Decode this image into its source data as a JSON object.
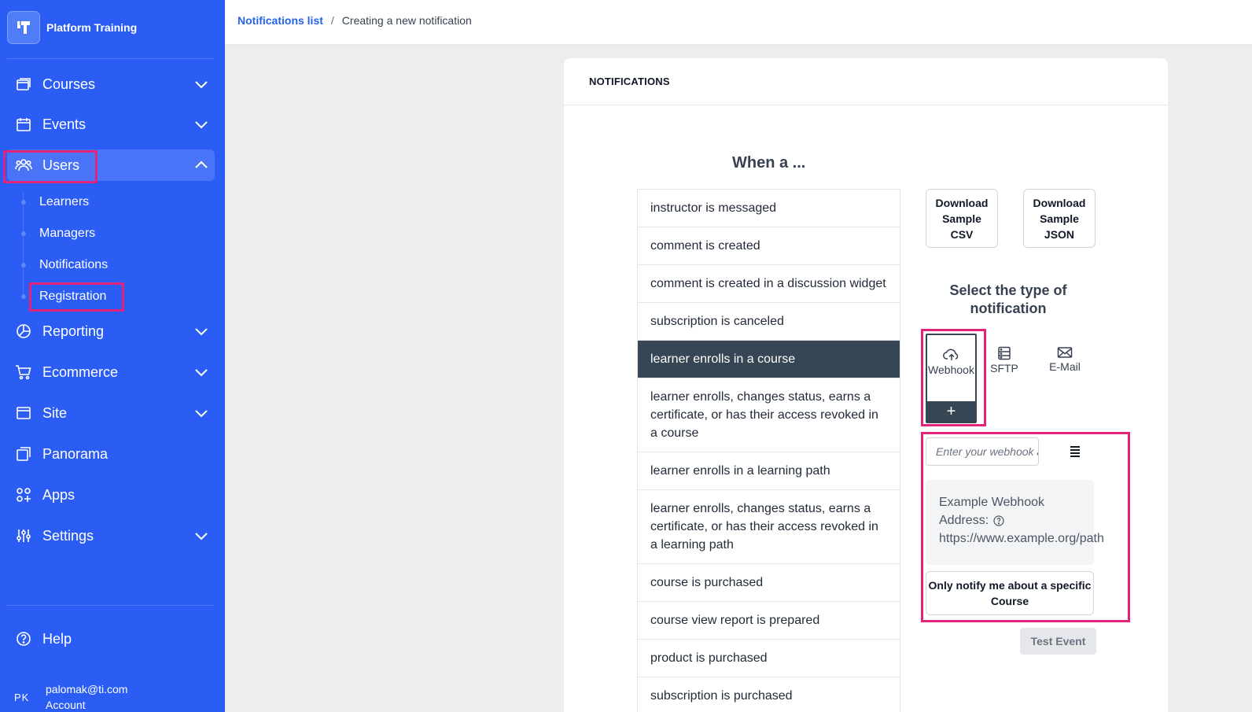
{
  "brand": {
    "name": "Platform Training",
    "logo_text": "T"
  },
  "sidebar": {
    "items": [
      {
        "label": "Courses",
        "icon": "courses-icon"
      },
      {
        "label": "Events",
        "icon": "calendar-icon"
      },
      {
        "label": "Users",
        "icon": "users-icon",
        "expanded": true
      },
      {
        "label": "Reporting",
        "icon": "pie-chart-icon"
      },
      {
        "label": "Ecommerce",
        "icon": "cart-icon"
      },
      {
        "label": "Site",
        "icon": "browser-icon"
      },
      {
        "label": "Panorama",
        "icon": "panorama-icon"
      },
      {
        "label": "Apps",
        "icon": "apps-icon"
      },
      {
        "label": "Settings",
        "icon": "sliders-icon"
      }
    ],
    "users_sub": [
      "Learners",
      "Managers",
      "Notifications",
      "Registration"
    ],
    "help": "Help",
    "account": {
      "initials": "PK",
      "email": "palomak@ti.com",
      "label": "Account"
    }
  },
  "breadcrumb": {
    "link": "Notifications list",
    "separator": "/",
    "current": "Creating a new notification"
  },
  "card": {
    "header": "NOTIFICATIONS",
    "when_title": "When a ...",
    "events": [
      "instructor is messaged",
      "comment is created",
      "comment is created in a discussion widget",
      "subscription is canceled",
      "learner enrolls in a course",
      "learner enrolls, changes status, earns a certificate, or has their access revoked in a course",
      "learner enrolls in a learning path",
      "learner enrolls, changes status, earns a certificate, or has their access revoked in a learning path",
      "course is purchased",
      "course view report is prepared",
      "product is purchased",
      "subscription is purchased"
    ],
    "selected_event": "learner enrolls in a course",
    "download_csv": [
      "Download",
      "Sample",
      "CSV"
    ],
    "download_json": [
      "Download",
      "Sample",
      "JSON"
    ],
    "select_type_title": "Select the type of notification",
    "types": {
      "webhook": "Webhook",
      "sftp": "SFTP",
      "email": "E-Mail",
      "add": "+"
    },
    "webhook_placeholder": "Enter your webhook address",
    "example": {
      "label": "Example Webhook",
      "address_label": "Address:",
      "url": "https://www.example.org/path"
    },
    "notify_button": "Only notify me about a specific Course",
    "test_button": "Test Event"
  },
  "colors": {
    "sidebar": "#2b5df5",
    "highlight": "#e0247a",
    "selected": "#374654",
    "link": "#2563eb"
  }
}
